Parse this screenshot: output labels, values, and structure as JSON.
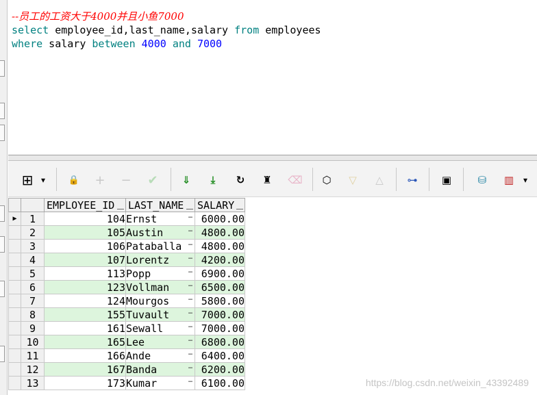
{
  "editor": {
    "comment": "--员工的工资大于4000并且小鱼7000",
    "line2": {
      "select": "select",
      "cols": " employee_id,last_name,salary ",
      "from": "from",
      "table": " employees"
    },
    "line3": {
      "where": "where",
      "col": " salary ",
      "between": "between",
      "n1": "4000",
      "and": "and",
      "n2": "7000"
    }
  },
  "toolbar": {
    "buttons": [
      {
        "name": "grid-view-icon",
        "glyph": "⊞"
      },
      {
        "name": "dropdown-arrow-icon",
        "glyph": "▾"
      },
      {
        "name": "lock-icon",
        "glyph": "🔒"
      },
      {
        "name": "insert-record-icon",
        "glyph": "+"
      },
      {
        "name": "delete-record-icon",
        "glyph": "−"
      },
      {
        "name": "post-changes-icon",
        "glyph": "✔"
      },
      {
        "name": "fetch-next-page-icon",
        "glyph": "⇓"
      },
      {
        "name": "fetch-last-page-icon",
        "glyph": "⤓"
      },
      {
        "name": "refresh-icon",
        "glyph": "↻"
      },
      {
        "name": "find-binoculars-icon",
        "glyph": "♜"
      },
      {
        "name": "clear-icon",
        "glyph": "⌫"
      },
      {
        "name": "export-icon",
        "glyph": "⬡"
      },
      {
        "name": "sort-down-icon",
        "glyph": "▽"
      },
      {
        "name": "sort-up-icon",
        "glyph": "△"
      },
      {
        "name": "query-builder-icon",
        "glyph": "⊶"
      },
      {
        "name": "save-icon",
        "glyph": "▣"
      },
      {
        "name": "database-icon",
        "glyph": "⛁"
      },
      {
        "name": "chart-icon",
        "glyph": "▥"
      },
      {
        "name": "chart-dropdown-icon",
        "glyph": "▾"
      }
    ]
  },
  "grid": {
    "columns": [
      "EMPLOYEE_ID",
      "LAST_NAME",
      "SALARY"
    ],
    "ellipsis": "…",
    "current_row_marker": "▶",
    "rows": [
      {
        "n": "1",
        "id": "104",
        "name": "Ernst",
        "salary": "6000.00"
      },
      {
        "n": "2",
        "id": "105",
        "name": "Austin",
        "salary": "4800.00"
      },
      {
        "n": "3",
        "id": "106",
        "name": "Pataballa",
        "salary": "4800.00"
      },
      {
        "n": "4",
        "id": "107",
        "name": "Lorentz",
        "salary": "4200.00"
      },
      {
        "n": "5",
        "id": "113",
        "name": "Popp",
        "salary": "6900.00"
      },
      {
        "n": "6",
        "id": "123",
        "name": "Vollman",
        "salary": "6500.00"
      },
      {
        "n": "7",
        "id": "124",
        "name": "Mourgos",
        "salary": "5800.00"
      },
      {
        "n": "8",
        "id": "155",
        "name": "Tuvault",
        "salary": "7000.00"
      },
      {
        "n": "9",
        "id": "161",
        "name": "Sewall",
        "salary": "7000.00"
      },
      {
        "n": "10",
        "id": "165",
        "name": "Lee",
        "salary": "6800.00"
      },
      {
        "n": "11",
        "id": "166",
        "name": "Ande",
        "salary": "6400.00"
      },
      {
        "n": "12",
        "id": "167",
        "name": "Banda",
        "salary": "6200.00"
      },
      {
        "n": "13",
        "id": "173",
        "name": "Kumar",
        "salary": "6100.00"
      }
    ]
  },
  "watermark": "https://blog.csdn.net/weixin_43392489"
}
